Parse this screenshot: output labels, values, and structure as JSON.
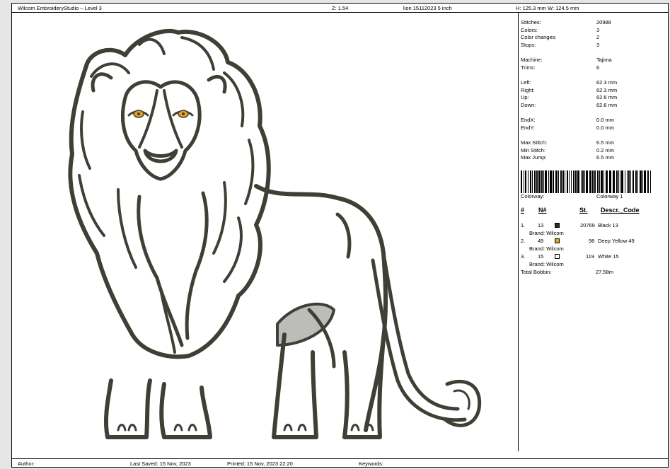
{
  "header": {
    "app": "Wilcom EmbroideryStudio – Level 3",
    "zoom": "Z: 1.54",
    "file": "lion 15112023 5 inch",
    "size": "H: 125.3 mm  W: 124.5 mm"
  },
  "stats": [
    {
      "label": "Stitches:",
      "value": "20988"
    },
    {
      "label": "Colors:",
      "value": "3"
    },
    {
      "label": "Color changes:",
      "value": "2"
    },
    {
      "label": "Stops:",
      "value": "3"
    },
    {
      "label": "Machine:",
      "value": "Tajima"
    },
    {
      "label": "Trims:",
      "value": "6"
    },
    {
      "label": "Left:",
      "value": "62.3 mm"
    },
    {
      "label": "Right:",
      "value": "62.3 mm"
    },
    {
      "label": "Up:",
      "value": "62.6 mm"
    },
    {
      "label": "Down:",
      "value": "62.6 mm"
    },
    {
      "label": "EndX:",
      "value": "0.0 mm"
    },
    {
      "label": "EndY:",
      "value": "0.0 mm"
    },
    {
      "label": "Max Stitch:",
      "value": "6.5 mm"
    },
    {
      "label": "Min Stitch:",
      "value": "0.2 mm"
    },
    {
      "label": "Max Jump:",
      "value": "6.5 mm"
    }
  ],
  "colorway": {
    "label": "Colorway:",
    "value": "Colorway 1"
  },
  "color_table": {
    "headers": [
      "#",
      "N#",
      "St.",
      "Descr._Code"
    ],
    "rows": [
      {
        "idx": "1.",
        "code": "13",
        "color": "#2b2b2b",
        "stitches": "20769",
        "desc": "Black 13",
        "brand": "Brand: Wilcom"
      },
      {
        "idx": "2.",
        "code": "49",
        "color": "#e3a21c",
        "stitches": "98",
        "desc": "Deep Yellow 49",
        "brand": "Brand: Wilcom"
      },
      {
        "idx": "3.",
        "code": "15",
        "color": "#ffffff",
        "stitches": "119",
        "desc": "White 15",
        "brand": "Brand: Wilcom"
      }
    ],
    "bobbin_label": "Total Bobbin:",
    "bobbin_value": "27.58m"
  },
  "footer": {
    "author": "Author:",
    "last_saved": "Last Saved: 15 Nov, 2023",
    "printed": "Printed: 15 Nov, 2023 22:20",
    "keywords": "Keywords:"
  },
  "design": {
    "thread_color": "#3f3f36",
    "eye_color": "#e3a21c"
  }
}
